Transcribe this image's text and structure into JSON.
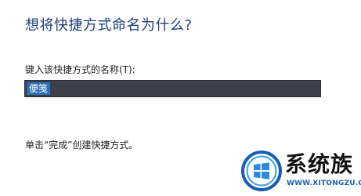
{
  "dialog": {
    "heading": "想将快捷方式命名为什么?",
    "name_label": "键入该快捷方式的名称(T):",
    "name_value": "便笺",
    "hint": "单击“完成”创建快捷方式。"
  },
  "watermark": {
    "site_name": "系统族",
    "url": "WWW.XITONGZU.COM",
    "logo_icon": "windows-logo-icon",
    "colors": {
      "ring_outer": "#1a5fb4",
      "ring_inner": "#3aa0e8",
      "logo_tiles": "#2b8be0",
      "url_text": "#1a5fb4"
    }
  },
  "colors": {
    "heading": "#1f3f7a",
    "input_background": "#3b3f4a",
    "selection": "#2d6fb6"
  }
}
